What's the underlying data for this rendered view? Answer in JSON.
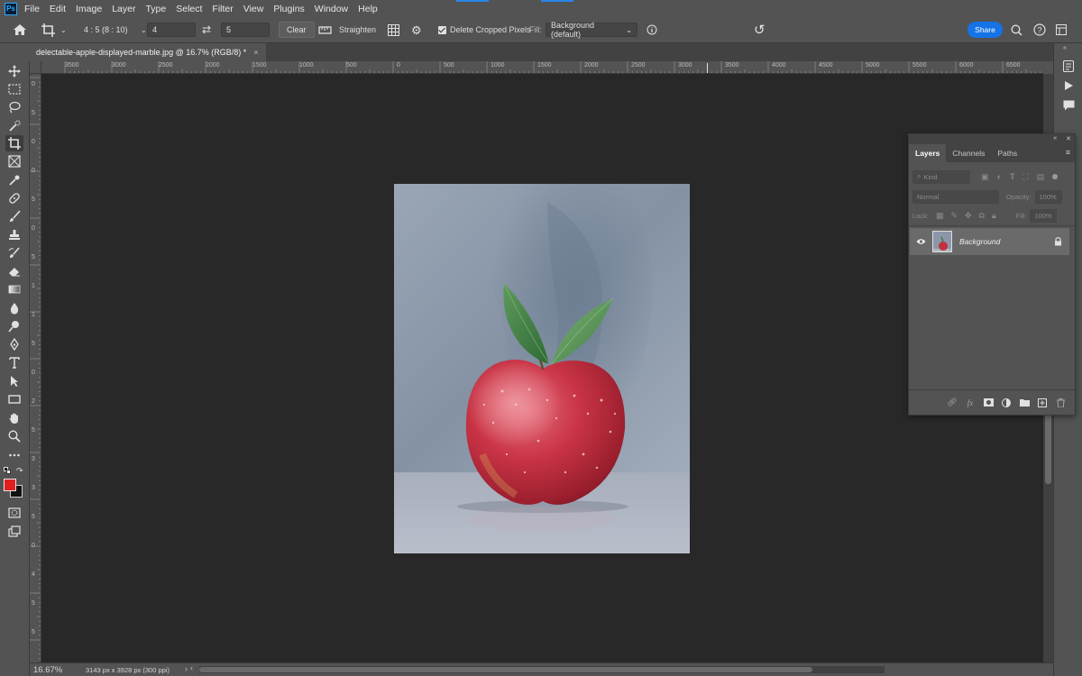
{
  "app": {
    "logo": "Ps"
  },
  "menu": [
    "File",
    "Edit",
    "Image",
    "Layer",
    "Type",
    "Select",
    "Filter",
    "View",
    "Plugins",
    "Window",
    "Help"
  ],
  "options": {
    "ratio_preset": "4 : 5 (8 : 10)",
    "width_value": "4",
    "height_value": "5",
    "clear_label": "Clear",
    "straighten_label": "Straighten",
    "delete_cropped_label": "Delete Cropped Pixels",
    "delete_cropped_checked": true,
    "fill_label": "Fill:",
    "fill_value": "Background (default)",
    "share_label": "Share"
  },
  "document": {
    "tab_title": "delectable-apple-displayed-marble.jpg @ 16.7% (RGB/8) *",
    "close_glyph": "×"
  },
  "ruler_top": [
    "3500",
    "3000",
    "2500",
    "2000",
    "1500",
    "1000",
    "500",
    "0",
    "500",
    "1000",
    "1500",
    "2000",
    "2500",
    "3000",
    "3500",
    "4000",
    "4500",
    "5000",
    "5500",
    "6000",
    "6500"
  ],
  "ruler_left": [
    "0",
    "5",
    "0",
    "0",
    "5",
    "0",
    "5",
    "1",
    "1",
    "5",
    "0",
    "2",
    "5",
    "3",
    "3",
    "5",
    "0",
    "4",
    "5",
    "5"
  ],
  "layers_panel": {
    "tabs": [
      "Layers",
      "Channels",
      "Paths"
    ],
    "active_tab": "Layers",
    "kind_placeholder": "Kind",
    "blend_mode": "Normal",
    "opacity_label": "Opacity:",
    "opacity_value": "100%",
    "lock_label": "Lock:",
    "fill_label": "Fill:",
    "fill_value": "100%",
    "layers": [
      {
        "name": "Background",
        "visible": true,
        "locked": true
      }
    ]
  },
  "status": {
    "zoom": "16.67%",
    "doc_size": "3143 px x 3928 px (300 ppi)"
  },
  "colors": {
    "foreground": "#e01f1f",
    "background": "#111111",
    "accent": "#1473e6"
  },
  "icons": {
    "toolbar": [
      "move-icon",
      "marquee-icon",
      "lasso-icon",
      "quick-select-icon",
      "crop-icon",
      "frame-icon",
      "eyedropper-icon",
      "healing-brush-icon",
      "brush-icon",
      "clone-stamp-icon",
      "history-brush-icon",
      "eraser-icon",
      "gradient-icon",
      "blur-icon",
      "dodge-icon",
      "pen-icon",
      "type-icon",
      "path-select-icon",
      "rectangle-icon",
      "hand-icon",
      "zoom-icon",
      "more-tools-icon"
    ]
  }
}
